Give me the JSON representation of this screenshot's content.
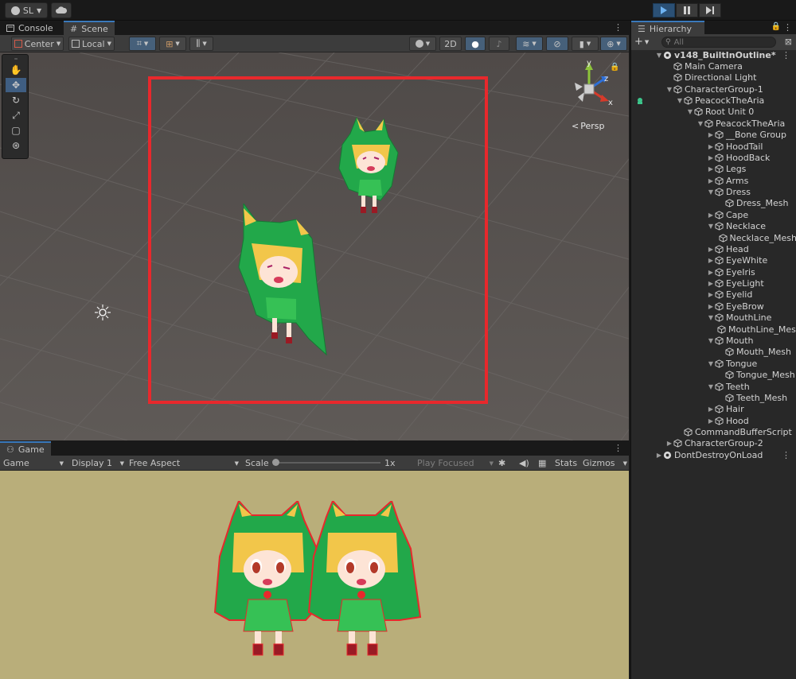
{
  "topbar": {
    "account_label": "SL",
    "cloud_icon": "cloud-icon",
    "play_icon": "play-icon",
    "pause_icon": "pause-icon",
    "step_icon": "step-icon"
  },
  "scene_panel": {
    "tabs": [
      {
        "label": "Console",
        "icon": "console-icon"
      },
      {
        "label": "Scene",
        "icon": "scene-hash-icon"
      }
    ],
    "toolbar": {
      "pivot_label": "Center",
      "space_label": "Local",
      "twod_label": "2D"
    },
    "gizmo": {
      "x_label": "x",
      "y_label": "y",
      "z_label": "z",
      "persp_label": "Persp"
    }
  },
  "game_panel": {
    "tab_label": "Game",
    "toolbar": {
      "game_select": "Game",
      "display_select": "Display 1",
      "aspect_select": "Free Aspect",
      "scale_label": "Scale",
      "scale_value": "1x",
      "play_mode_select": "Play Focused",
      "stats_label": "Stats",
      "gizmos_label": "Gizmos"
    }
  },
  "hierarchy": {
    "tab_label": "Hierarchy",
    "search_placeholder": "All",
    "rows": [
      {
        "label": "v148_BuiltInOutline*",
        "depth": 0,
        "arrow": "down",
        "icon": "scene",
        "bold": true,
        "kebab": true
      },
      {
        "label": "Main Camera",
        "depth": 1,
        "arrow": "none",
        "icon": "cube"
      },
      {
        "label": "Directional Light",
        "depth": 1,
        "arrow": "none",
        "icon": "cube"
      },
      {
        "label": "CharacterGroup-1",
        "depth": 1,
        "arrow": "down",
        "icon": "cube"
      },
      {
        "label": "PeacockTheAria",
        "depth": 2,
        "arrow": "down",
        "icon": "cube"
      },
      {
        "label": "Root Unit 0",
        "depth": 3,
        "arrow": "down",
        "icon": "cube"
      },
      {
        "label": "PeacockTheAria",
        "depth": 4,
        "arrow": "down",
        "icon": "cube"
      },
      {
        "label": "__Bone Group",
        "depth": 5,
        "arrow": "right",
        "icon": "cube"
      },
      {
        "label": "HoodTail",
        "depth": 5,
        "arrow": "right",
        "icon": "cube"
      },
      {
        "label": "HoodBack",
        "depth": 5,
        "arrow": "right",
        "icon": "cube"
      },
      {
        "label": "Legs",
        "depth": 5,
        "arrow": "right",
        "icon": "cube"
      },
      {
        "label": "Arms",
        "depth": 5,
        "arrow": "right",
        "icon": "cube"
      },
      {
        "label": "Dress",
        "depth": 5,
        "arrow": "down",
        "icon": "cube"
      },
      {
        "label": "Dress_Mesh",
        "depth": 6,
        "arrow": "none",
        "icon": "cube"
      },
      {
        "label": "Cape",
        "depth": 5,
        "arrow": "right",
        "icon": "cube"
      },
      {
        "label": "Necklace",
        "depth": 5,
        "arrow": "down",
        "icon": "cube"
      },
      {
        "label": "Necklace_Mesh",
        "depth": 6,
        "arrow": "none",
        "icon": "cube"
      },
      {
        "label": "Head",
        "depth": 5,
        "arrow": "right",
        "icon": "cube"
      },
      {
        "label": "EyeWhite",
        "depth": 5,
        "arrow": "right",
        "icon": "cube"
      },
      {
        "label": "EyeIris",
        "depth": 5,
        "arrow": "right",
        "icon": "cube"
      },
      {
        "label": "EyeLight",
        "depth": 5,
        "arrow": "right",
        "icon": "cube"
      },
      {
        "label": "Eyelid",
        "depth": 5,
        "arrow": "right",
        "icon": "cube"
      },
      {
        "label": "EyeBrow",
        "depth": 5,
        "arrow": "right",
        "icon": "cube"
      },
      {
        "label": "MouthLine",
        "depth": 5,
        "arrow": "down",
        "icon": "cube"
      },
      {
        "label": "MouthLine_Mesh",
        "depth": 6,
        "arrow": "none",
        "icon": "cube"
      },
      {
        "label": "Mouth",
        "depth": 5,
        "arrow": "down",
        "icon": "cube"
      },
      {
        "label": "Mouth_Mesh",
        "depth": 6,
        "arrow": "none",
        "icon": "cube"
      },
      {
        "label": "Tongue",
        "depth": 5,
        "arrow": "down",
        "icon": "cube"
      },
      {
        "label": "Tongue_Mesh",
        "depth": 6,
        "arrow": "none",
        "icon": "cube"
      },
      {
        "label": "Teeth",
        "depth": 5,
        "arrow": "down",
        "icon": "cube"
      },
      {
        "label": "Teeth_Mesh",
        "depth": 6,
        "arrow": "none",
        "icon": "cube"
      },
      {
        "label": "Hair",
        "depth": 5,
        "arrow": "right",
        "icon": "cube"
      },
      {
        "label": "Hood",
        "depth": 5,
        "arrow": "right",
        "icon": "cube"
      },
      {
        "label": "CommandBufferScript",
        "depth": 2,
        "arrow": "none",
        "icon": "cube"
      },
      {
        "label": "CharacterGroup-2",
        "depth": 1,
        "arrow": "right",
        "icon": "cube"
      },
      {
        "label": "DontDestroyOnLoad",
        "depth": 0,
        "arrow": "right",
        "icon": "scene",
        "kebab": true
      }
    ]
  },
  "colors": {
    "selection_frame": "#e8282c",
    "accent_blue": "#3a79bb",
    "scene_bg": "#555555",
    "game_bg": "#b9ae7a",
    "character_green": "#22a84a",
    "character_hair": "#f2c64a"
  }
}
